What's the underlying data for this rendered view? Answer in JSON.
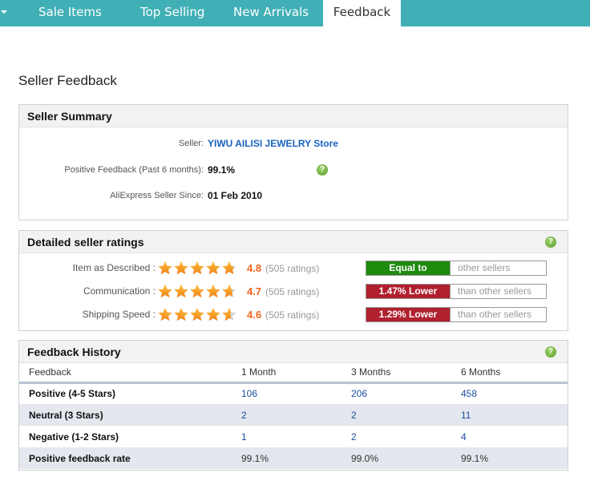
{
  "nav": {
    "tabs": [
      {
        "label": "Sale Items",
        "active": false
      },
      {
        "label": "Top Selling",
        "active": false
      },
      {
        "label": "New Arrivals",
        "active": false
      },
      {
        "label": "Feedback",
        "active": true
      }
    ]
  },
  "page_title": "Seller Feedback",
  "seller_summary": {
    "title": "Seller Summary",
    "seller_label": "Seller:",
    "seller_name": "YIWU AILISI JEWELRY Store",
    "positive_label": "Positive Feedback (Past 6 months):",
    "positive_value": "99.1%",
    "since_label": "AliExpress Seller Since:",
    "since_value": "01 Feb 2010",
    "help_icon": "?"
  },
  "detailed_ratings": {
    "title": "Detailed seller ratings",
    "help_icon": "?",
    "rows": [
      {
        "label": "Item as Described :",
        "stars": 4.8,
        "score": "4.8",
        "count": "(505 ratings)",
        "badge": "Equal to",
        "badge_color": "#1e8a0e",
        "compare": "other sellers"
      },
      {
        "label": "Communication :",
        "stars": 4.7,
        "score": "4.7",
        "count": "(505 ratings)",
        "badge": "1.47% Lower",
        "badge_color": "#b0202e",
        "compare": "than other sellers"
      },
      {
        "label": "Shipping Speed :",
        "stars": 4.6,
        "score": "4.6",
        "count": "(505 ratings)",
        "badge": "1.29% Lower",
        "badge_color": "#b0202e",
        "compare": "than other sellers"
      }
    ]
  },
  "feedback_history": {
    "title": "Feedback History",
    "help_icon": "?",
    "columns": [
      "Feedback",
      "1 Month",
      "3 Months",
      "6 Months"
    ],
    "rows": [
      {
        "name": "Positive (4-5 Stars)",
        "values": [
          "106",
          "206",
          "458"
        ]
      },
      {
        "name": "Neutral (3 Stars)",
        "values": [
          "2",
          "2",
          "11"
        ]
      },
      {
        "name": "Negative (1-2 Stars)",
        "values": [
          "1",
          "2",
          "4"
        ]
      },
      {
        "name": "Positive feedback rate",
        "values": [
          "99.1%",
          "99.0%",
          "99.1%"
        ]
      }
    ]
  }
}
